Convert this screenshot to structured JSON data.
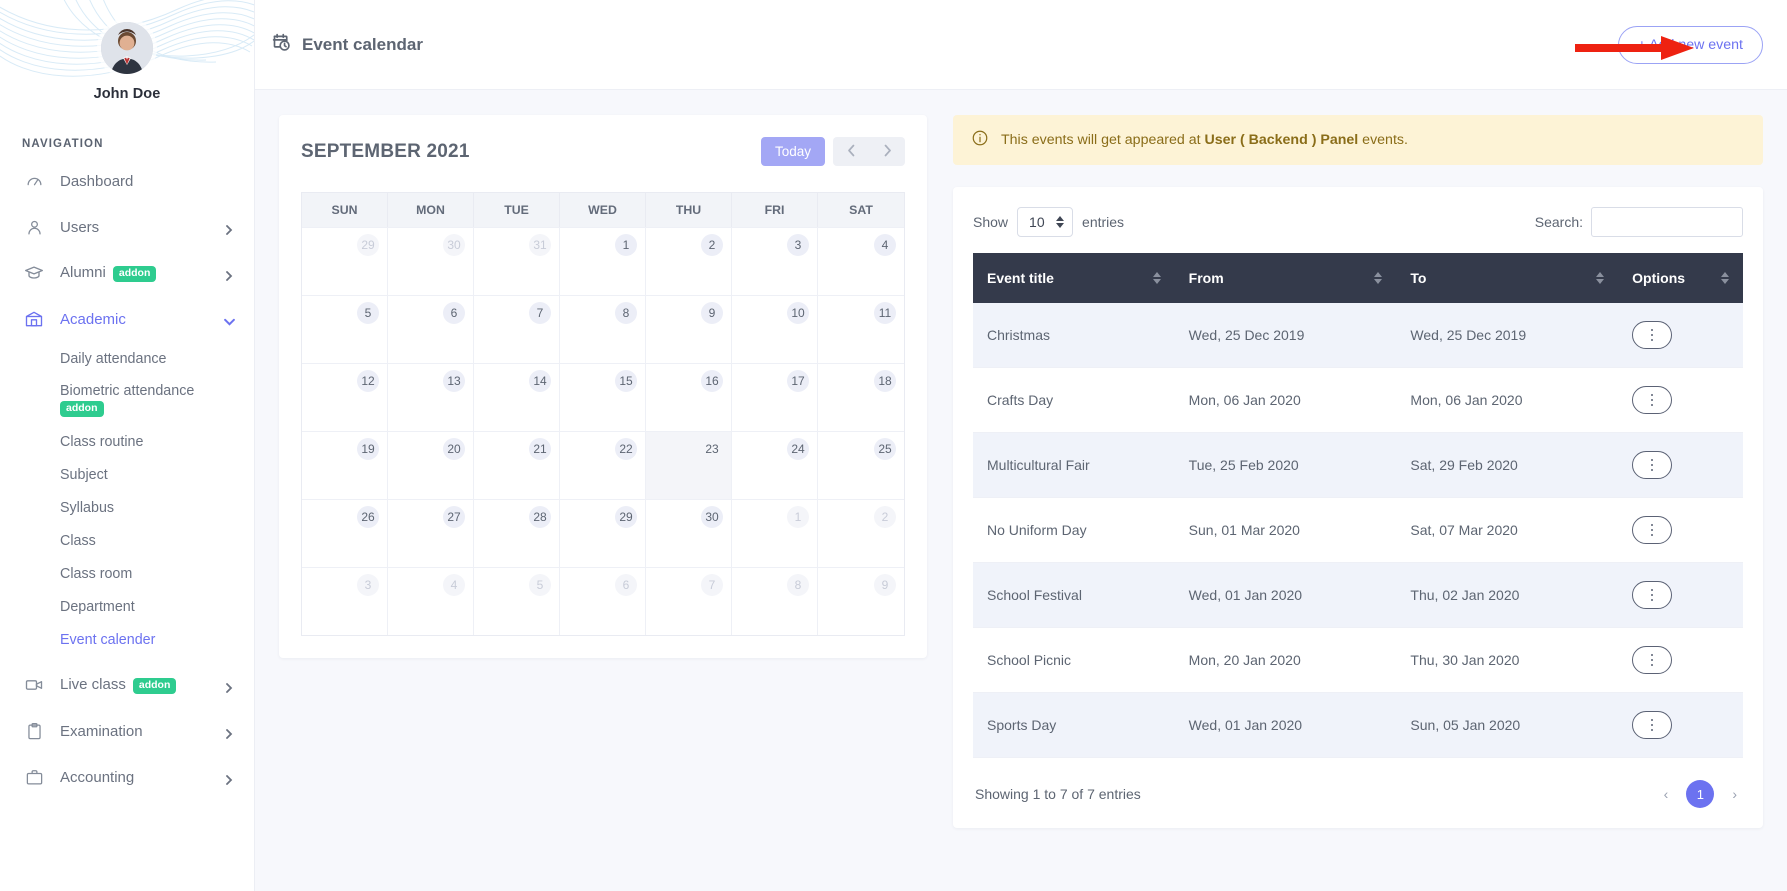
{
  "sidebar": {
    "profile_name": "John Doe",
    "nav_label": "NAVIGATION",
    "items": [
      {
        "label": "Dashboard",
        "icon": "speedometer-icon",
        "has_chevron": false,
        "addon": null
      },
      {
        "label": "Users",
        "icon": "user-icon",
        "has_chevron": true,
        "addon": null
      },
      {
        "label": "Alumni",
        "icon": "graduation-cap-icon",
        "has_chevron": true,
        "addon": "addon"
      },
      {
        "label": "Academic",
        "icon": "school-icon",
        "has_chevron": true,
        "addon": null,
        "active": true
      }
    ],
    "academic_sub": [
      {
        "label": "Daily attendance",
        "addon": null
      },
      {
        "label": "Biometric attendance",
        "addon": "addon"
      },
      {
        "label": "Class routine",
        "addon": null
      },
      {
        "label": "Subject",
        "addon": null
      },
      {
        "label": "Syllabus",
        "addon": null
      },
      {
        "label": "Class",
        "addon": null
      },
      {
        "label": "Class room",
        "addon": null
      },
      {
        "label": "Department",
        "addon": null
      },
      {
        "label": "Event calender",
        "addon": null,
        "active": true
      }
    ],
    "items_after": [
      {
        "label": "Live class",
        "icon": "video-camera-icon",
        "has_chevron": true,
        "addon": "addon"
      },
      {
        "label": "Examination",
        "icon": "clipboard-icon",
        "has_chevron": true,
        "addon": null
      },
      {
        "label": "Accounting",
        "icon": "briefcase-icon",
        "has_chevron": true,
        "addon": null
      }
    ]
  },
  "topbar": {
    "title": "Event calendar",
    "title_icon": "calendar-clock-icon",
    "add_button": "+  Add new event"
  },
  "calendar": {
    "title": "SEPTEMBER 2021",
    "today_button": "Today",
    "prev_icon": "chevron-left-icon",
    "next_icon": "chevron-right-icon",
    "dow": [
      "SUN",
      "MON",
      "TUE",
      "WED",
      "THU",
      "FRI",
      "SAT"
    ],
    "weeks": [
      [
        {
          "d": "29",
          "muted": true
        },
        {
          "d": "30",
          "muted": true
        },
        {
          "d": "31",
          "muted": true
        },
        {
          "d": "1"
        },
        {
          "d": "2"
        },
        {
          "d": "3"
        },
        {
          "d": "4"
        }
      ],
      [
        {
          "d": "5"
        },
        {
          "d": "6"
        },
        {
          "d": "7"
        },
        {
          "d": "8"
        },
        {
          "d": "9"
        },
        {
          "d": "10"
        },
        {
          "d": "11"
        }
      ],
      [
        {
          "d": "12"
        },
        {
          "d": "13"
        },
        {
          "d": "14"
        },
        {
          "d": "15"
        },
        {
          "d": "16"
        },
        {
          "d": "17"
        },
        {
          "d": "18"
        }
      ],
      [
        {
          "d": "19"
        },
        {
          "d": "20"
        },
        {
          "d": "21"
        },
        {
          "d": "22"
        },
        {
          "d": "23",
          "today": true,
          "plain": true
        },
        {
          "d": "24"
        },
        {
          "d": "25"
        }
      ],
      [
        {
          "d": "26"
        },
        {
          "d": "27"
        },
        {
          "d": "28"
        },
        {
          "d": "29"
        },
        {
          "d": "30"
        },
        {
          "d": "1",
          "muted": true
        },
        {
          "d": "2",
          "muted": true
        }
      ],
      [
        {
          "d": "3",
          "muted": true
        },
        {
          "d": "4",
          "muted": true
        },
        {
          "d": "5",
          "muted": true
        },
        {
          "d": "6",
          "muted": true
        },
        {
          "d": "7",
          "muted": true
        },
        {
          "d": "8",
          "muted": true
        },
        {
          "d": "9",
          "muted": true
        }
      ]
    ]
  },
  "alert": {
    "icon": "info-circle-icon",
    "text_before": "This events will get appeared at ",
    "text_bold": "User ( Backend ) Panel",
    "text_after": " events."
  },
  "table_controls": {
    "show_label": "Show",
    "entries_value": "10",
    "entries_label": "entries",
    "search_label": "Search:",
    "search_value": "",
    "search_placeholder": ""
  },
  "table": {
    "columns": [
      "Event title",
      "From",
      "To",
      "Options"
    ],
    "rows": [
      {
        "title": "Christmas",
        "from": "Wed, 25 Dec 2019",
        "to": "Wed, 25 Dec 2019"
      },
      {
        "title": "Crafts Day",
        "from": "Mon, 06 Jan 2020",
        "to": "Mon, 06 Jan 2020"
      },
      {
        "title": "Multicultural Fair",
        "from": "Tue, 25 Feb 2020",
        "to": "Sat, 29 Feb 2020"
      },
      {
        "title": "No Uniform Day",
        "from": "Sun, 01 Mar 2020",
        "to": "Sat, 07 Mar 2020"
      },
      {
        "title": "School Festival",
        "from": "Wed, 01 Jan 2020",
        "to": "Thu, 02 Jan 2020"
      },
      {
        "title": "School Picnic",
        "from": "Mon, 20 Jan 2020",
        "to": "Thu, 30 Jan 2020"
      },
      {
        "title": "Sports Day",
        "from": "Wed, 01 Jan 2020",
        "to": "Sun, 05 Jan 2020"
      }
    ],
    "options_icon": "three-dots-vertical-icon"
  },
  "footer": {
    "info": "Showing 1 to 7 of 7 entries",
    "prev": "‹",
    "page": "1",
    "next": "›"
  },
  "annotation": {
    "type": "red-arrow",
    "color": "#ee2211"
  },
  "colors": {
    "accent": "#6c72f0",
    "addon_green": "#2ecc8f",
    "header_dark": "#343a4b",
    "alert_bg": "#fdf3d6",
    "alert_text": "#8a6d19"
  }
}
